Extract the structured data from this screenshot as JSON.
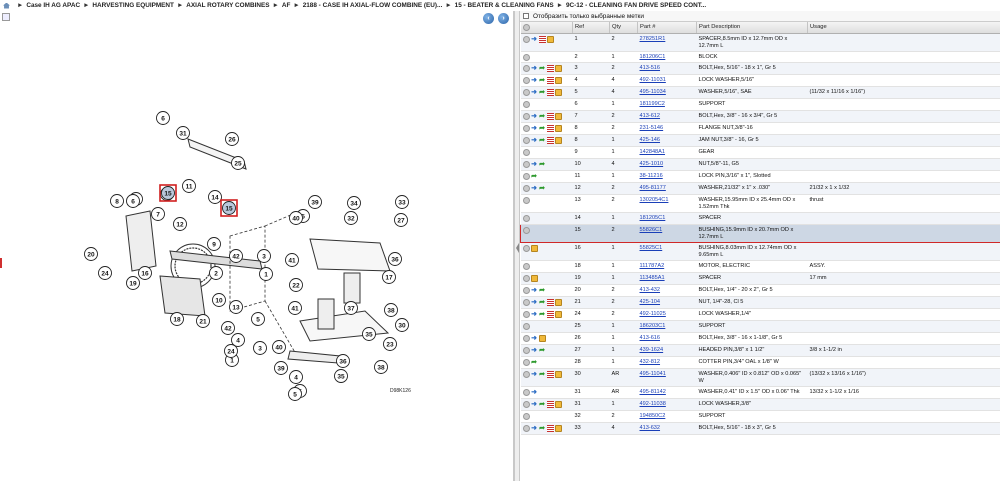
{
  "breadcrumb": [
    "Case IH AG APAC",
    "HARVESTING EQUIPMENT",
    "AXIAL ROTARY COMBINES",
    "AF",
    "2188 - CASE IH AXIAL-FLOW COMBINE (EU)...",
    "15 - BEATER & CLEANING FANS",
    "9C-12 - CLEANING FAN DRIVE SPEED CONT..."
  ],
  "diagram": {
    "code": "D98K126",
    "callouts": [
      "6",
      "31",
      "26",
      "25",
      "8",
      "16",
      "11",
      "14",
      "15",
      "15",
      "8",
      "6",
      "7",
      "12",
      "5",
      "39",
      "34",
      "33",
      "32",
      "27",
      "40",
      "20",
      "9",
      "42",
      "3",
      "1",
      "36",
      "24",
      "19",
      "16",
      "2",
      "41",
      "10",
      "13",
      "17",
      "22",
      "37",
      "38",
      "18",
      "21",
      "42",
      "4",
      "41",
      "5",
      "30",
      "35",
      "23",
      "40",
      "38",
      "1",
      "4",
      "39",
      "36",
      "5",
      "5",
      "35",
      "3",
      "24"
    ]
  },
  "filter": {
    "label": "Отобразить только выбранные метки"
  },
  "table": {
    "headers": [
      "",
      "Ref",
      "Qty",
      "Part #",
      "Part Description",
      "Usage"
    ],
    "rows": [
      {
        "ref": "1",
        "qty": "2",
        "part": "278251R1",
        "desc": "SPACER,8.5mm ID x 12.7mm OD x 12.7mm L",
        "usage": "",
        "icons": "cilb"
      },
      {
        "ref": "2",
        "qty": "1",
        "part": "181206C1",
        "desc": "BLOCK",
        "usage": "",
        "icons": "c"
      },
      {
        "ref": "3",
        "qty": "2",
        "part": "413-516",
        "desc": "BOLT,Hex, 5/16\" - 18 x 1\", Gr 5",
        "usage": "",
        "icons": "cialb"
      },
      {
        "ref": "4",
        "qty": "4",
        "part": "492-11031",
        "desc": "LOCK WASHER,5/16\"",
        "usage": "",
        "icons": "cialb"
      },
      {
        "ref": "5",
        "qty": "4",
        "part": "495-11034",
        "desc": "WASHER,5/16\", SAE",
        "usage": "(11/32 x 11/16 x 1/16\")",
        "icons": "cialb"
      },
      {
        "ref": "6",
        "qty": "1",
        "part": "181199C2",
        "desc": "SUPPORT",
        "usage": "",
        "icons": "c"
      },
      {
        "ref": "7",
        "qty": "2",
        "part": "413-612",
        "desc": "BOLT,Hex, 3/8\" - 16 x 3/4\", Gr 5",
        "usage": "",
        "icons": "cialb"
      },
      {
        "ref": "8",
        "qty": "2",
        "part": "231-5146",
        "desc": "FLANGE NUT,3/8\"-16",
        "usage": "",
        "icons": "cialb"
      },
      {
        "ref": "8",
        "qty": "1",
        "part": "425-146",
        "desc": "JAM NUT,3/8\" - 16, Gr 5",
        "usage": "",
        "icons": "cialb"
      },
      {
        "ref": "9",
        "qty": "1",
        "part": "142848A1",
        "desc": "GEAR",
        "usage": "",
        "icons": "c"
      },
      {
        "ref": "10",
        "qty": "4",
        "part": "425-1010",
        "desc": "NUT,5/8\"-11, G5",
        "usage": "",
        "icons": "cia"
      },
      {
        "ref": "11",
        "qty": "1",
        "part": "38-11216",
        "desc": "LOCK PIN,3/16\" x 1\", Slotted",
        "usage": "",
        "icons": "ca"
      },
      {
        "ref": "12",
        "qty": "2",
        "part": "495-81177",
        "desc": "WASHER,21/32\" x 1\" x .030\"",
        "usage": "21/32 x 1 x 1/32",
        "icons": "cia"
      },
      {
        "ref": "13",
        "qty": "2",
        "part": "1302054C1",
        "desc": "WASHER,15.95mm ID x 25.4mm OD x 1.52mm Thk",
        "usage": "thrust",
        "icons": "c"
      },
      {
        "ref": "14",
        "qty": "1",
        "part": "181205C1",
        "desc": "SPACER",
        "usage": "",
        "icons": "c"
      },
      {
        "ref": "15",
        "qty": "2",
        "part": "55826C1",
        "desc": "BUSHING,15.9mm ID x 20.7mm OD x 12.7mm L",
        "usage": "",
        "icons": "c"
      },
      {
        "ref": "16",
        "qty": "1",
        "part": "55825C1",
        "desc": "BUSHING,8.03mm ID x 12.74mm OD x 9.65mm L",
        "usage": "",
        "icons": "cb"
      },
      {
        "ref": "18",
        "qty": "1",
        "part": "111787A2",
        "desc": "MOTOR, ELECTRIC",
        "usage": "ASSY.",
        "icons": "c"
      },
      {
        "ref": "19",
        "qty": "1",
        "part": "113485A1",
        "desc": "SPACER",
        "usage": "17 mm",
        "icons": "cb"
      },
      {
        "ref": "20",
        "qty": "2",
        "part": "413-432",
        "desc": "BOLT,Hex, 1/4\" - 20 x 2\", Gr 5",
        "usage": "",
        "icons": "cia"
      },
      {
        "ref": "21",
        "qty": "2",
        "part": "425-104",
        "desc": "NUT, 1/4\"-28, Cl 5",
        "usage": "",
        "icons": "cialb"
      },
      {
        "ref": "24",
        "qty": "2",
        "part": "492-11025",
        "desc": "LOCK WASHER,1/4\"",
        "usage": "",
        "icons": "cialb"
      },
      {
        "ref": "25",
        "qty": "1",
        "part": "186203C1",
        "desc": "SUPPORT",
        "usage": "",
        "icons": "c"
      },
      {
        "ref": "26",
        "qty": "1",
        "part": "413-616",
        "desc": "BOLT,Hex, 3/8\" - 16 x 1-1/8\", Gr 5",
        "usage": "",
        "icons": "cib"
      },
      {
        "ref": "27",
        "qty": "1",
        "part": "439-1624",
        "desc": "HEADED PIN,3/8\" x 1 1/2\"",
        "usage": "3/8 x 1-1/2 in",
        "icons": "cia"
      },
      {
        "ref": "28",
        "qty": "1",
        "part": "432-812",
        "desc": "COTTER PIN,3/4\" OAL x 1/8\" W",
        "usage": "",
        "icons": "ca"
      },
      {
        "ref": "30",
        "qty": "AR",
        "part": "495-11041",
        "desc": "WASHER,0.406\" ID x 0.812\" OD x 0.065\" W",
        "usage": "(13/32 x 13/16 x 1/16\")",
        "icons": "cialb"
      },
      {
        "ref": "31",
        "qty": "AR",
        "part": "495-81142",
        "desc": "WASHER,0.41\" ID x 1.5\" OD x 0.06\" Thk",
        "usage": "13/32 x 1-1/2 x 1/16",
        "icons": "ci"
      },
      {
        "ref": "31",
        "qty": "1",
        "part": "492-11038",
        "desc": "LOCK WASHER,3/8\"",
        "usage": "",
        "icons": "cialb"
      },
      {
        "ref": "32",
        "qty": "2",
        "part": "194850C2",
        "desc": "SUPPORT",
        "usage": "",
        "icons": "c"
      },
      {
        "ref": "33",
        "qty": "4",
        "part": "413-632",
        "desc": "BOLT,Hex, 5/16\" - 18 x 3\", Gr 5",
        "usage": "",
        "icons": "cialb"
      }
    ]
  }
}
